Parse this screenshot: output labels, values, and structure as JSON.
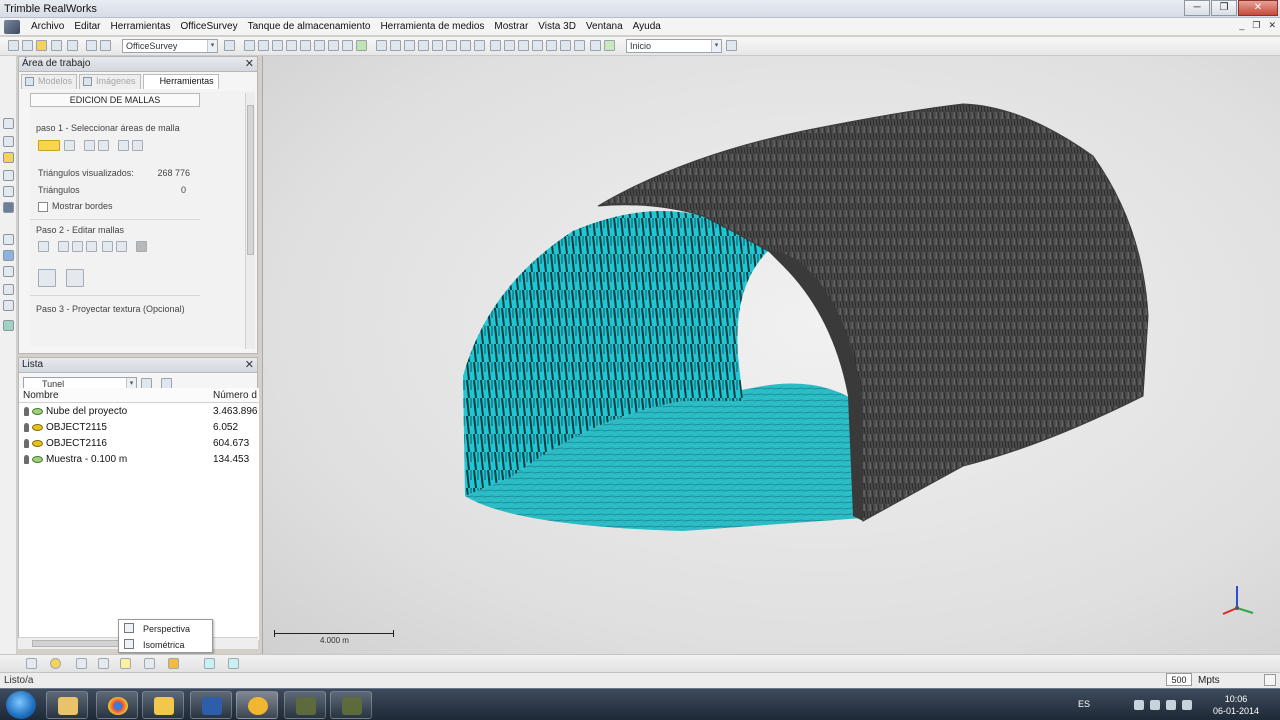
{
  "window": {
    "title": "Trimble RealWorks",
    "controls": {
      "minimize": "─",
      "maximize": "❐",
      "close": "✕"
    }
  },
  "menu": [
    "Archivo",
    "Editar",
    "Herramientas",
    "OfficeSurvey",
    "Tanque de almacenamiento",
    "Herramienta de medios",
    "Mostrar",
    "Vista 3D",
    "Ventana",
    "Ayuda"
  ],
  "menu_controls": [
    "_",
    "❐",
    "✕"
  ],
  "toolbar": {
    "project_combo": "OfficeSurvey",
    "view_combo": "Inicio",
    "combo_arrow": "▾"
  },
  "workspace": {
    "title": "Área de trabajo",
    "close": "✕",
    "tabs": [
      "Modelos",
      "Imágenes",
      "Herramientas"
    ],
    "active_tab": "Herramientas",
    "tool": {
      "title": "EDICION DE MALLAS",
      "step1": "paso 1 - Seleccionar áreas de malla",
      "tri_visible_label": "Triángulos visualizados:",
      "tri_visible_value": "268 776",
      "tri_label": "Triángulos",
      "tri_value": "0",
      "show_edges": "Mostrar bordes",
      "step2": "Paso 2 - Editar mallas",
      "step3": "Paso 3 - Proyectar textura (Opcional)"
    }
  },
  "list_panel": {
    "title": "Lista",
    "close": "✕",
    "filter": "Tunel",
    "combo_arrow": "▾",
    "columns": [
      "Nombre",
      "Número d"
    ],
    "rows": [
      {
        "name": "Nube del proyecto",
        "count": "3.463.896",
        "kind": "cloud"
      },
      {
        "name": "OBJECT2115",
        "count": "6.052",
        "kind": "object"
      },
      {
        "name": "OBJECT2116",
        "count": "604.673",
        "kind": "object"
      },
      {
        "name": "Muestra - 0.100 m",
        "count": "134.453",
        "kind": "sample"
      }
    ]
  },
  "view_popup": {
    "items": [
      "Perspectiva",
      "Isométrica"
    ]
  },
  "viewport": {
    "scale_label": "4.000 m",
    "mesh_colors": {
      "outer": "#4d4d4d",
      "inner": "#1ec9d4",
      "floor": "#29b8c2"
    }
  },
  "status": {
    "text": "Listo/a",
    "points_value": "500",
    "points_unit": "Mpts"
  },
  "taskbar": {
    "language": "ES",
    "time": "10:06",
    "date": "06-01-2014"
  }
}
